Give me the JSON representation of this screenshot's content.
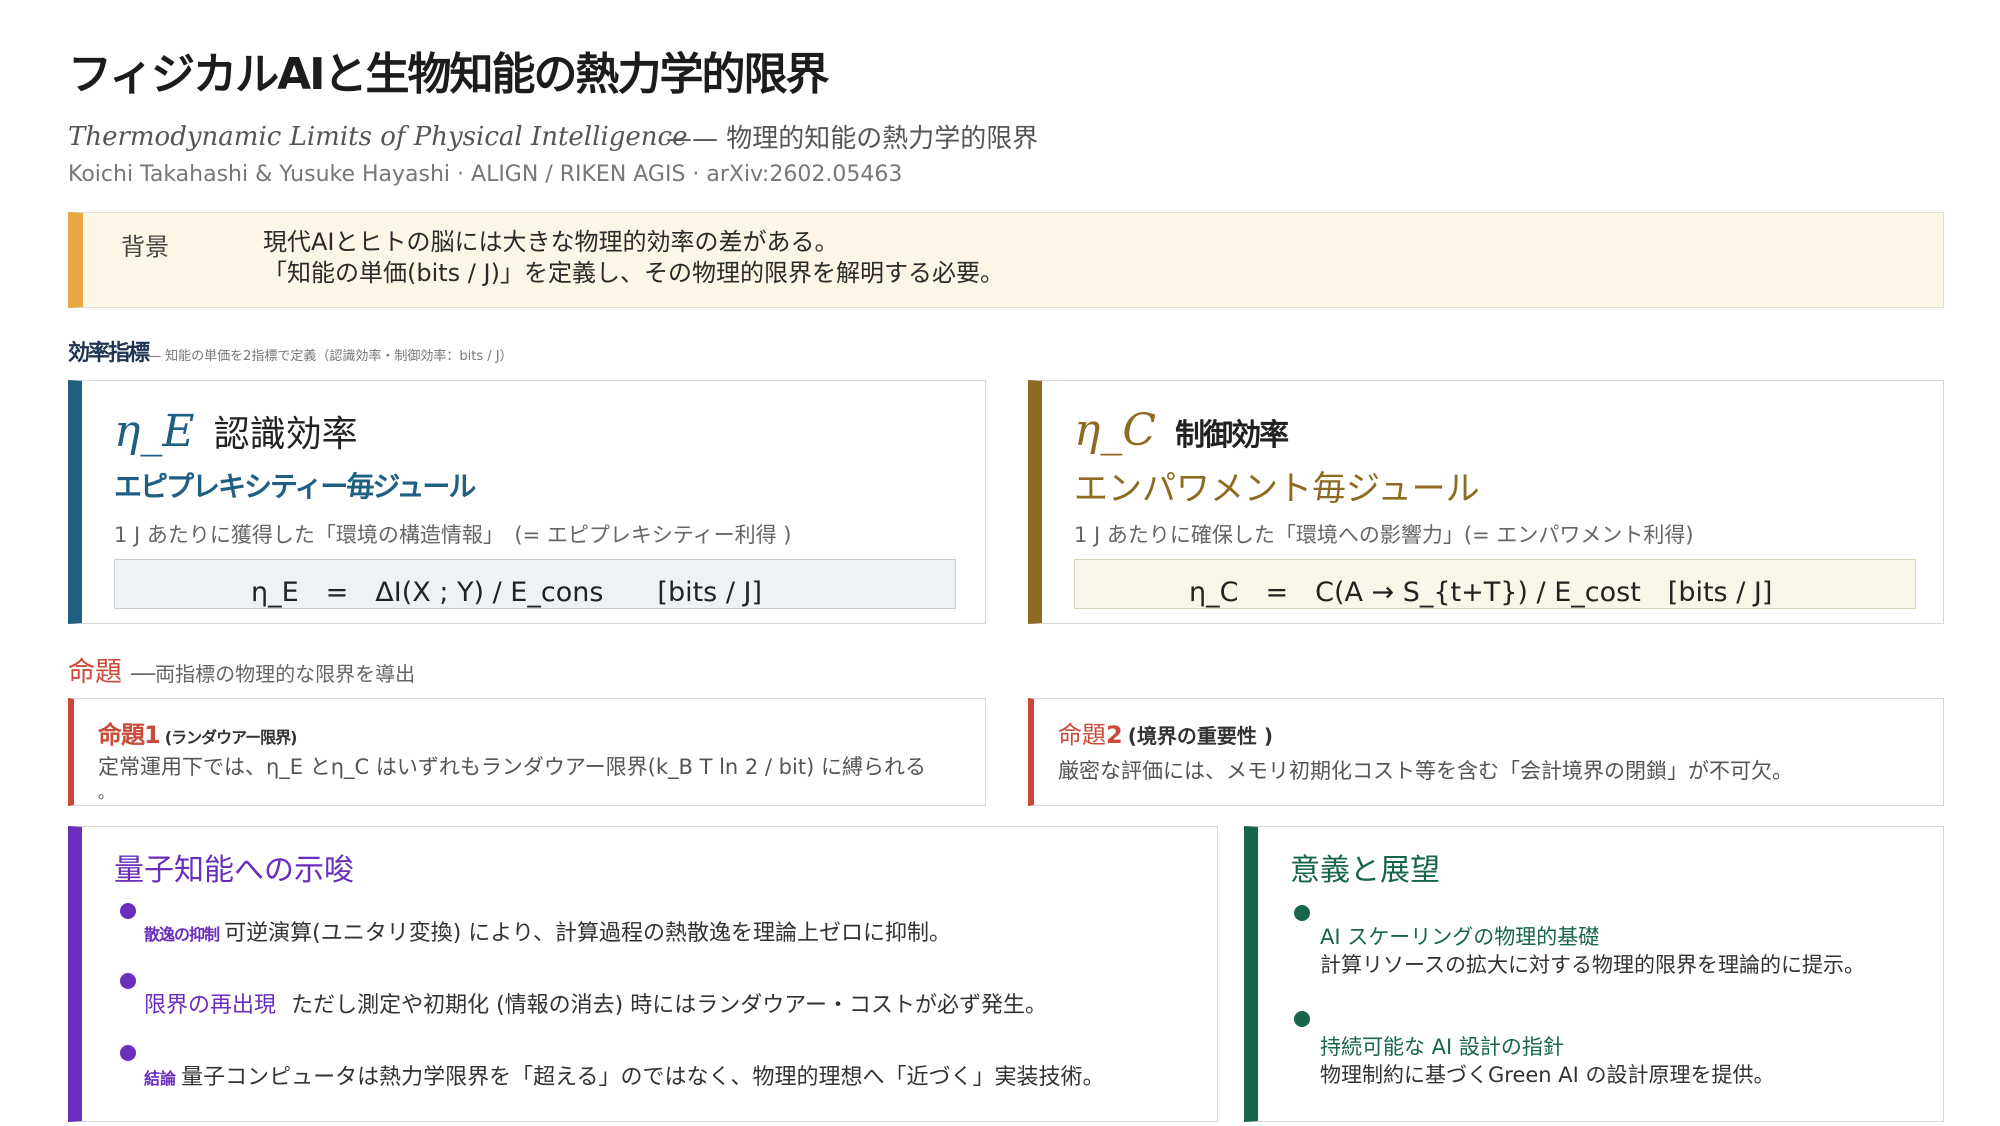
{
  "header": {
    "title": "フィジカルAIと生物知能の熱力学的限界",
    "subtitle_en": "Thermodynamic Limits of Physical Intelligence",
    "subtitle_jp": "—— 物理的知能の熱力学的限界",
    "authors": "Koichi Takahashi & Yusuke Hayashi · ALIGN / RIKEN AGIS · arXiv:2602.05463"
  },
  "background": {
    "label": "背景",
    "line1": "現代AIとヒトの脳には大きな物理的効率の差がある。",
    "line2": "「知能の単価(bits / J)」を定義し、その物理的限界を解明する必要。"
  },
  "metrics": {
    "heading": "効率指標",
    "sub": "— 知能の単価を2指標で定義（認識効率・制御効率：bits / J）",
    "eta_e": {
      "symbol": "η_E",
      "name": "認識効率",
      "subtitle": "エピプレキシティー毎ジュール",
      "desc": "1 J あたりに獲得した「環境の構造情報」　(= エピプレキシティー利得 )",
      "formula": "η_E　=　ΔI(X ; Y) / E_cons　　[bits / J]"
    },
    "eta_c": {
      "symbol": "η_C",
      "name": "制御効率",
      "subtitle": "エンパワメント毎ジュール",
      "desc": "1 J あたりに確保した「環境への影響力」(= エンパワメント利得)",
      "formula": "η_C　=　C(A → S_{t+T}) / E_cost　[bits / J]"
    }
  },
  "propositions": {
    "heading": "命題",
    "sub": "──両指標の物理的な限界を導出",
    "p1": {
      "title": "命題1",
      "tag": "(ランダウアー限界)",
      "text": "定常運用下では、η_E とη_C はいずれもランダウアー限界(k_B T ln 2 / bit) に縛られる",
      "text2": "。"
    },
    "p2": {
      "title_a": "命題",
      "title_b": "2",
      "tag": "(境界の重要性 )",
      "text": "厳密な評価には、メモリ初期化コスト等を含む「会計境界の閉鎖」が不可欠。"
    }
  },
  "quantum": {
    "heading": "量子知能への示唆",
    "items": [
      {
        "label": "散逸の抑制",
        "text": "可逆演算(ユニタリ変換) により、計算過程の熱散逸を理論上ゼロに抑制。"
      },
      {
        "label": "限界の再出現",
        "text": "ただし測定や初期化 (情報の消去) 時にはランダウアー・コストが必ず発生。"
      },
      {
        "label": "結論",
        "text": "量子コンピュータは熱力学限界を「超える」のではなく、物理的理想へ「近づく」実装技術。"
      }
    ]
  },
  "outlook": {
    "heading": "意義と展望",
    "items": [
      {
        "title": "AI スケーリングの物理的基礎",
        "text": "計算リソースの拡大に対する物理的限界を理論的に提示。"
      },
      {
        "title": "持続可能な AI 設計の指針",
        "text": "物理制約に基づくGreen AI の設計原理を提供。"
      }
    ]
  },
  "colors": {
    "accent_blue": "#1e5f82",
    "accent_gold": "#8f6b21",
    "accent_red": "#c94a38",
    "accent_purple": "#6a2dbd",
    "accent_green": "#17664a",
    "background_yellow": "#e6a845"
  }
}
